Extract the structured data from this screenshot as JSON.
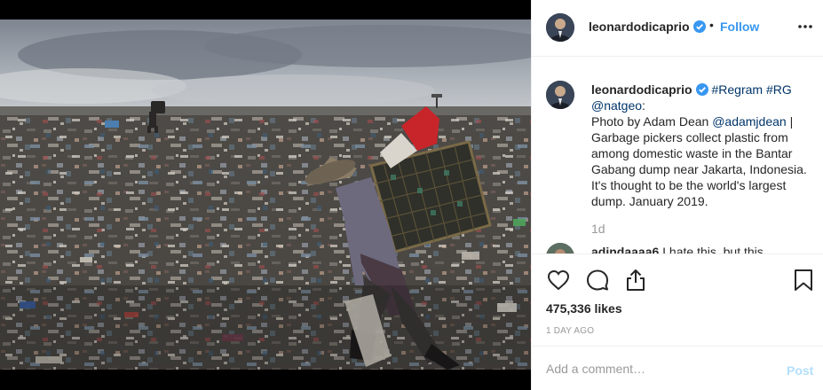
{
  "post": {
    "photo_alt": "Garbage picker carrying a basket across the Bantar Gabang dump"
  },
  "header": {
    "username": "leonardodicaprio",
    "separator": "•",
    "follow_label": "Follow",
    "verified_icon": "verified-badge-icon",
    "more_icon": "more-options-icon"
  },
  "caption": {
    "username": "leonardodicaprio",
    "hashtags": [
      "#Regram",
      "#RG"
    ],
    "mention_source": "@natgeo",
    "line_after_source": ":",
    "text_part1": "Photo by Adam Dean ",
    "mention_photographer": "@adamjdean",
    "text_part2": " | Garbage pickers collect plastic from among domestic waste in the Bantar Gabang dump near Jakarta, Indonesia. It's thought to be the world's largest dump. January 2019.",
    "age": "1d"
  },
  "next_comment": {
    "username": "adindaaaa6",
    "text": "I hate this, but this"
  },
  "actions": {
    "like_icon": "heart-icon",
    "comment_icon": "comment-icon",
    "share_icon": "share-icon",
    "save_icon": "bookmark-icon",
    "likes": "475,336 likes",
    "time": "1 DAY AGO"
  },
  "composer": {
    "placeholder": "Add a comment…",
    "post_label": "Post"
  },
  "colors": {
    "link_blue": "#3897f0",
    "hashtag_blue": "#003569",
    "post_disabled": "#b2dffc",
    "text": "#262626",
    "muted": "#999999"
  }
}
